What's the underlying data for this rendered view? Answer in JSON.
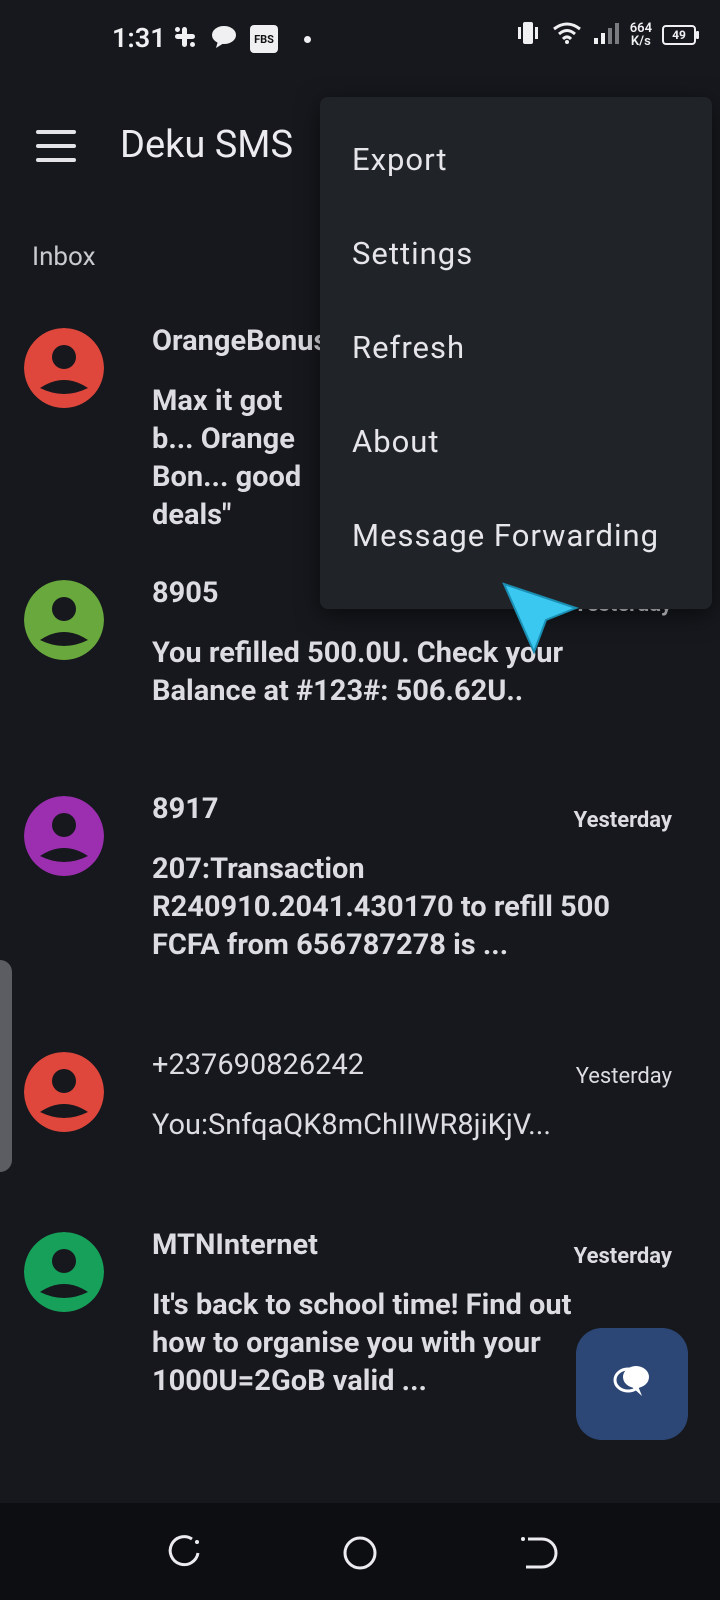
{
  "status_bar": {
    "time": "1:31",
    "fbs_label": "FBS",
    "net_speed_value": "664",
    "net_speed_unit": "K/s",
    "battery": "49"
  },
  "app_bar": {
    "title": "Deku SMS"
  },
  "section_label": "Inbox",
  "overflow_menu": {
    "items": [
      "Export",
      "Settings",
      "Refresh",
      "About",
      "Message Forwarding"
    ]
  },
  "messages": [
    {
      "sender": "OrangeBonus",
      "time": "",
      "preview": "Max it got b... Orange Bon... good deals\"",
      "avatar_color": "#e0473c",
      "unread": true
    },
    {
      "sender": "8905",
      "time": "Yesterday",
      "preview": "You refilled 500.0U. Check your Balance at #123#: 506.62U..",
      "avatar_color": "#68a83c",
      "unread": true
    },
    {
      "sender": "8917",
      "time": "Yesterday",
      "preview": "207:Transaction R240910.2041.430170 to refill 500 FCFA from 656787278 is ...",
      "avatar_color": "#9b2fb0",
      "unread": true
    },
    {
      "sender": "+237690826242",
      "time": "Yesterday",
      "preview": "You:SnfqaQK8mChIIWR8jiKjV...",
      "avatar_color": "#e0473c",
      "unread": false
    },
    {
      "sender": "MTNInternet",
      "time": "Yesterday",
      "preview": "It's back to school time! Find out how to organise you with your 1000U=2GoB valid ...",
      "avatar_color": "#17a05a",
      "unread": true
    }
  ],
  "colors": {
    "background": "#16181d",
    "menu_background": "#202328",
    "fab_background": "#2c4775",
    "cursor": "#3ac8f0"
  },
  "icons": {
    "menu": "hamburger-menu-icon",
    "fab": "new-conversation-icon",
    "cursor": "pointer-cursor-icon",
    "nav": [
      "recents-icon",
      "home-icon",
      "back-icon"
    ]
  }
}
